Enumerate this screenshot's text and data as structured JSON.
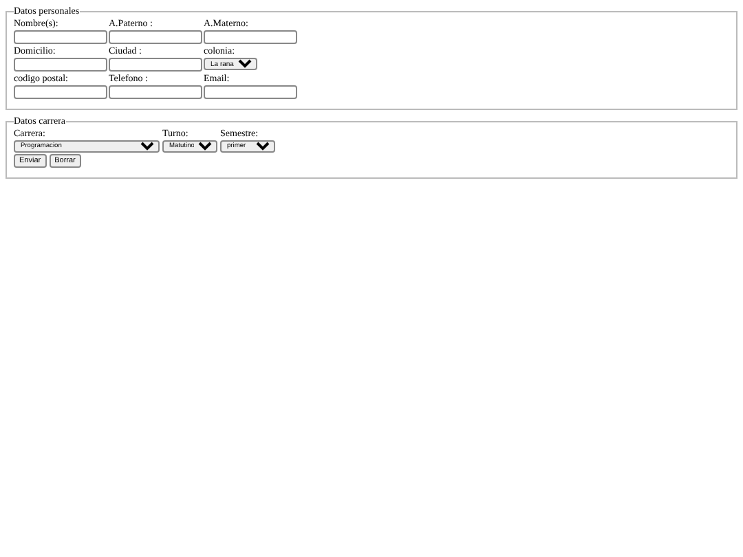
{
  "personal": {
    "legend": "Datos personales",
    "rows": [
      [
        {
          "label": "Nombre(s):",
          "kind": "text"
        },
        {
          "label": "A.Paterno :",
          "kind": "text"
        },
        {
          "label": "A.Materno:",
          "kind": "text"
        }
      ],
      [
        {
          "label": "Domicilio:",
          "kind": "text"
        },
        {
          "label": "Ciudad :",
          "kind": "text"
        },
        {
          "label": "colonia:",
          "kind": "select",
          "value": "La rana"
        }
      ],
      [
        {
          "label": "codigo postal:",
          "kind": "text"
        },
        {
          "label": "Telefono :",
          "kind": "text"
        },
        {
          "label": "Email:",
          "kind": "text"
        }
      ]
    ]
  },
  "carrera": {
    "legend": "Datos carrera",
    "fields": [
      {
        "label": "Carrera:",
        "value": "Programacion"
      },
      {
        "label": "Turno:",
        "value": "Matutino"
      },
      {
        "label": "Semestre:",
        "value": "primer"
      }
    ],
    "buttons": [
      "Enviar",
      "Borrar"
    ]
  }
}
